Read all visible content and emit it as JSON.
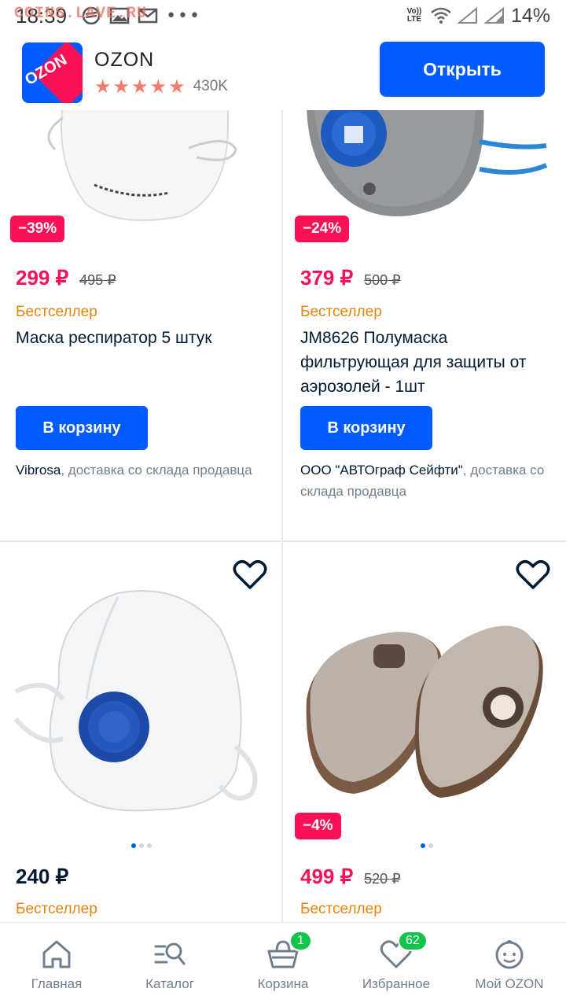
{
  "status_bar": {
    "time": "18:39",
    "volte": "Vo)) LTE",
    "battery": "14%"
  },
  "watermark": "COINS.LAVE.RU",
  "app_banner": {
    "app_name": "OZON",
    "logo_text": "OZON",
    "rating_stars": 5,
    "reviews_count": "430K",
    "open_button": "Открыть"
  },
  "products": [
    {
      "discount": "−39%",
      "price": "299 ₽",
      "old_price": "495 ₽",
      "tag": "Бестселлер",
      "title": "Маска респиратор 5 штук",
      "cart_button": "В корзину",
      "seller_name": "Vibrosa",
      "delivery": ", доставка со склада продавца"
    },
    {
      "discount": "−24%",
      "price": "379 ₽",
      "old_price": "500 ₽",
      "tag": "Бестселлер",
      "title": "JM8626 Полумаска фильтрующая для защиты от аэрозолей - 1шт",
      "cart_button": "В корзину",
      "seller_name": "ООО \"АВТОграф Сейфти\"",
      "delivery": ", доставка со склада продавца"
    },
    {
      "price": "240 ₽",
      "tag": "Бестселлер"
    },
    {
      "discount": "−4%",
      "price": "499 ₽",
      "old_price": "520 ₽",
      "tag": "Бестселлер"
    }
  ],
  "bottom_nav": {
    "home": "Главная",
    "catalog": "Каталог",
    "cart": "Корзина",
    "cart_badge": "1",
    "favorites": "Избранное",
    "favorites_badge": "62",
    "profile": "Мой OZON"
  },
  "colors": {
    "brand_blue": "#005bff",
    "sale_pink": "#f91155",
    "bestseller_orange": "#e8830c",
    "badge_green": "#10c44c"
  }
}
